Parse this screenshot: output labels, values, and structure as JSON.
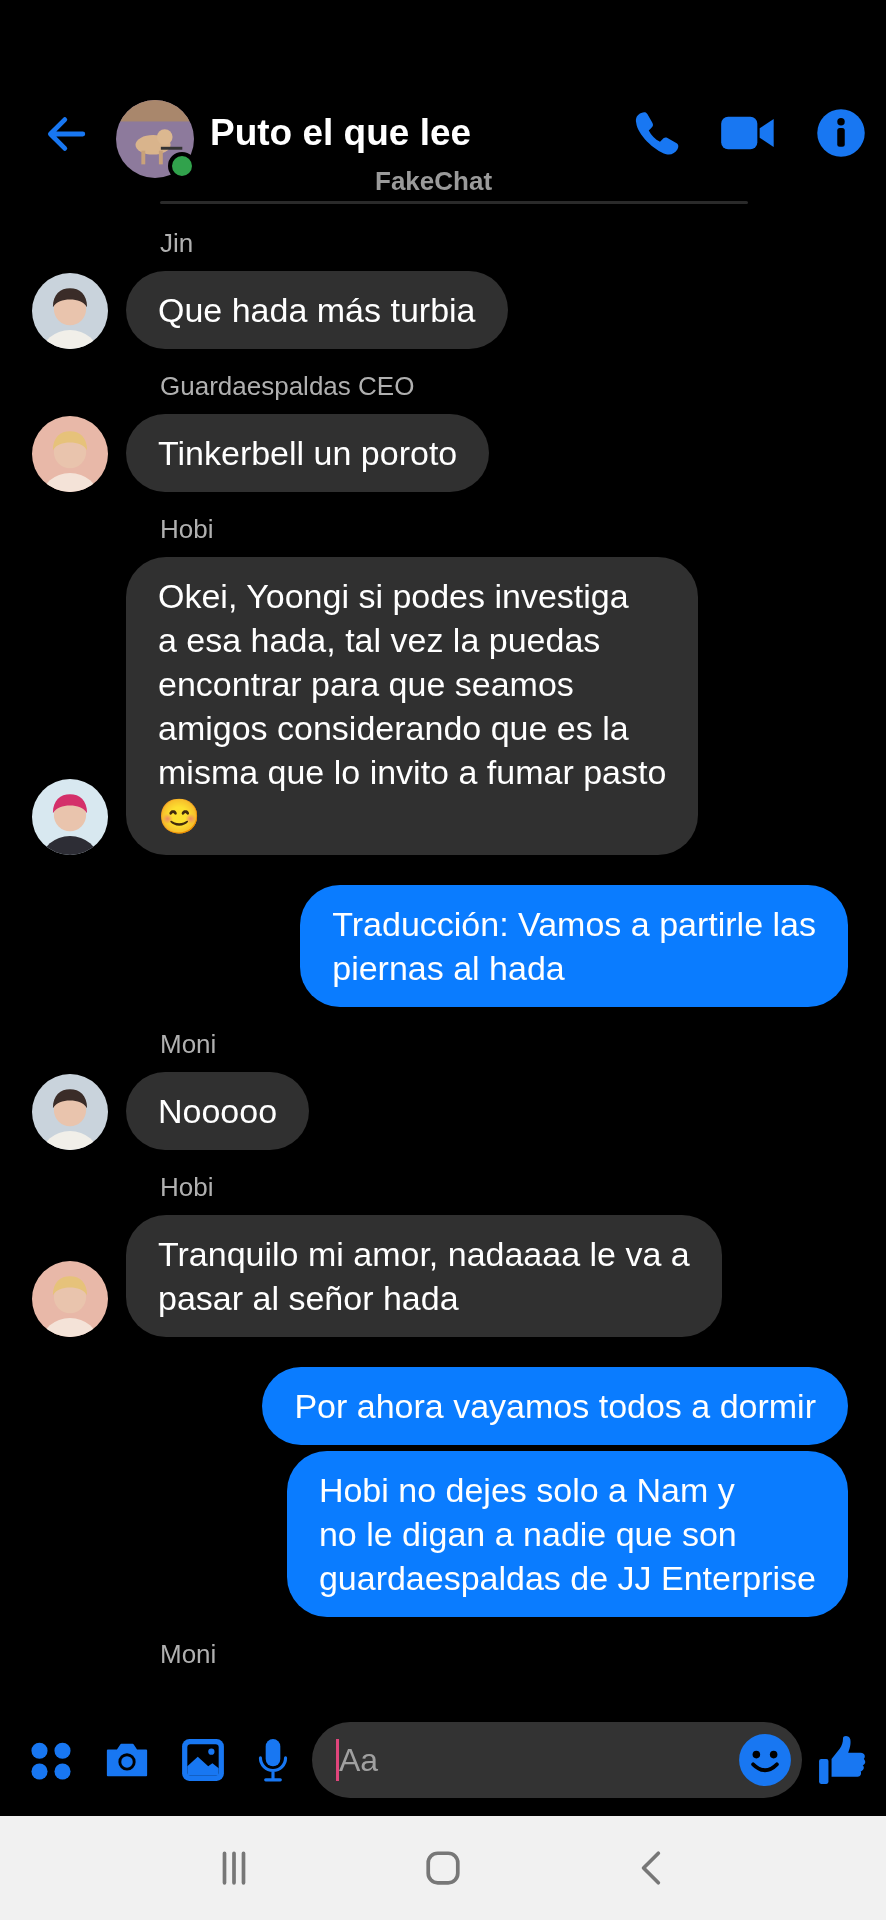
{
  "header": {
    "title": "Puto el que lee",
    "subtitle": "FakeChat",
    "online": true
  },
  "messages": [
    {
      "sender": "Jin",
      "kind": "received",
      "text": "Que hada más turbia"
    },
    {
      "sender": "Guardaespaldas CEO",
      "kind": "received",
      "text": "Tinkerbell un poroto"
    },
    {
      "sender": "Hobi",
      "kind": "received",
      "text": "Okei, Yoongi si podes investiga\na esa hada, tal vez la puedas\nencontrar para que seamos\namigos considerando que es la\nmisma que lo invito a fumar pasto\n😊"
    },
    {
      "kind": "sent",
      "text": "Traducción: Vamos a partirle las\npiernas al hada"
    },
    {
      "sender": "Moni",
      "kind": "received",
      "text": "Nooooo"
    },
    {
      "sender": "Hobi",
      "kind": "received",
      "text": "Tranquilo mi amor, nadaaaa le va a\npasar al señor hada"
    },
    {
      "kind": "sent",
      "text": "Por ahora vayamos todos a dormir"
    },
    {
      "kind": "sent",
      "text": "Hobi no dejes solo a Nam y\nno le digan a nadie que son\nguardaespaldas de JJ Enterprise"
    }
  ],
  "trailing_sender": "Moni",
  "composer": {
    "placeholder": "Aa"
  }
}
